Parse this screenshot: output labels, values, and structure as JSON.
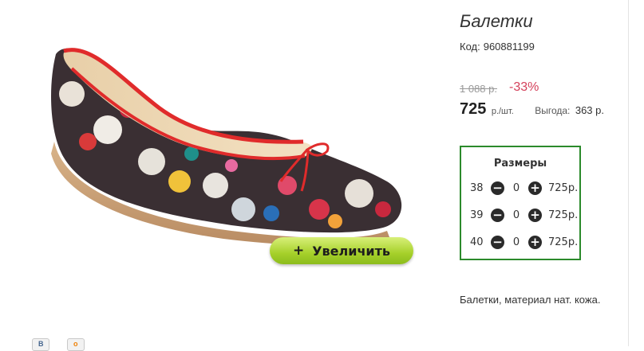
{
  "product": {
    "title": "Балетки",
    "code_label": "Код:",
    "code": "960881199",
    "old_price": "1 088 р.",
    "discount": "-33%",
    "price": "725",
    "price_unit": "р./шт.",
    "benefit_label": "Выгода:",
    "benefit_value": "363 р.",
    "description": "Балетки, материал нат. кожа."
  },
  "zoom_button": {
    "icon": "+",
    "label": "Увеличить"
  },
  "sizes": {
    "title": "Размеры",
    "rows": [
      {
        "size": "38",
        "qty": "0",
        "price": "725р."
      },
      {
        "size": "39",
        "qty": "0",
        "price": "725р."
      },
      {
        "size": "40",
        "qty": "0",
        "price": "725р."
      }
    ]
  },
  "social": [
    {
      "name": "vk-icon",
      "glyph": "В"
    },
    {
      "name": "odnoklassniki-icon",
      "glyph": "о"
    }
  ],
  "colors": {
    "accent_green": "#2b8a2b",
    "discount_red": "#d4405a",
    "button_green": "#a6d02a"
  }
}
